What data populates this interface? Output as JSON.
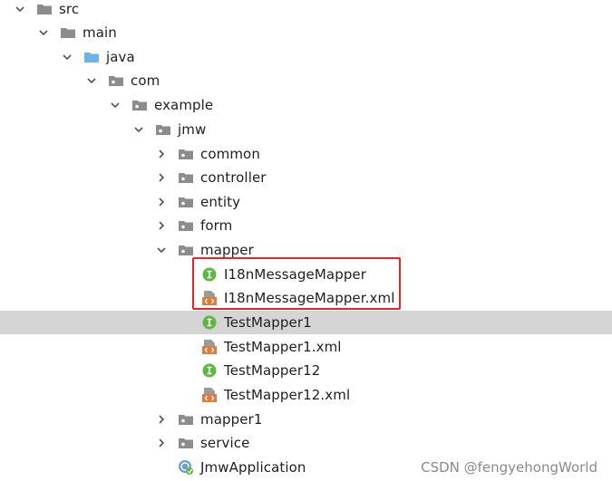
{
  "tree": {
    "src": "src",
    "main": "main",
    "java": "java",
    "com": "com",
    "example": "example",
    "jmw": "jmw",
    "common": "common",
    "controller": "controller",
    "entity": "entity",
    "form": "form",
    "mapper": "mapper",
    "i18n_mapper": "I18nMessageMapper",
    "i18n_mapper_xml": "I18nMessageMapper.xml",
    "test_mapper1": "TestMapper1",
    "test_mapper1_xml": "TestMapper1.xml",
    "test_mapper12": "TestMapper12",
    "test_mapper12_xml": "TestMapper12.xml",
    "mapper1": "mapper1",
    "service": "service",
    "jmw_application": "JmwApplication"
  },
  "selected_item": "TestMapper1",
  "watermark": "CSDN @fengyehongWorld",
  "colors": {
    "folder_gray": "#8c8c8c",
    "folder_java": "#6cb4e8",
    "interface_green": "#62b543",
    "xml_orange": "#e07b39",
    "highlight_red": "#e4262b",
    "selection_gray": "#d5d5d5"
  }
}
